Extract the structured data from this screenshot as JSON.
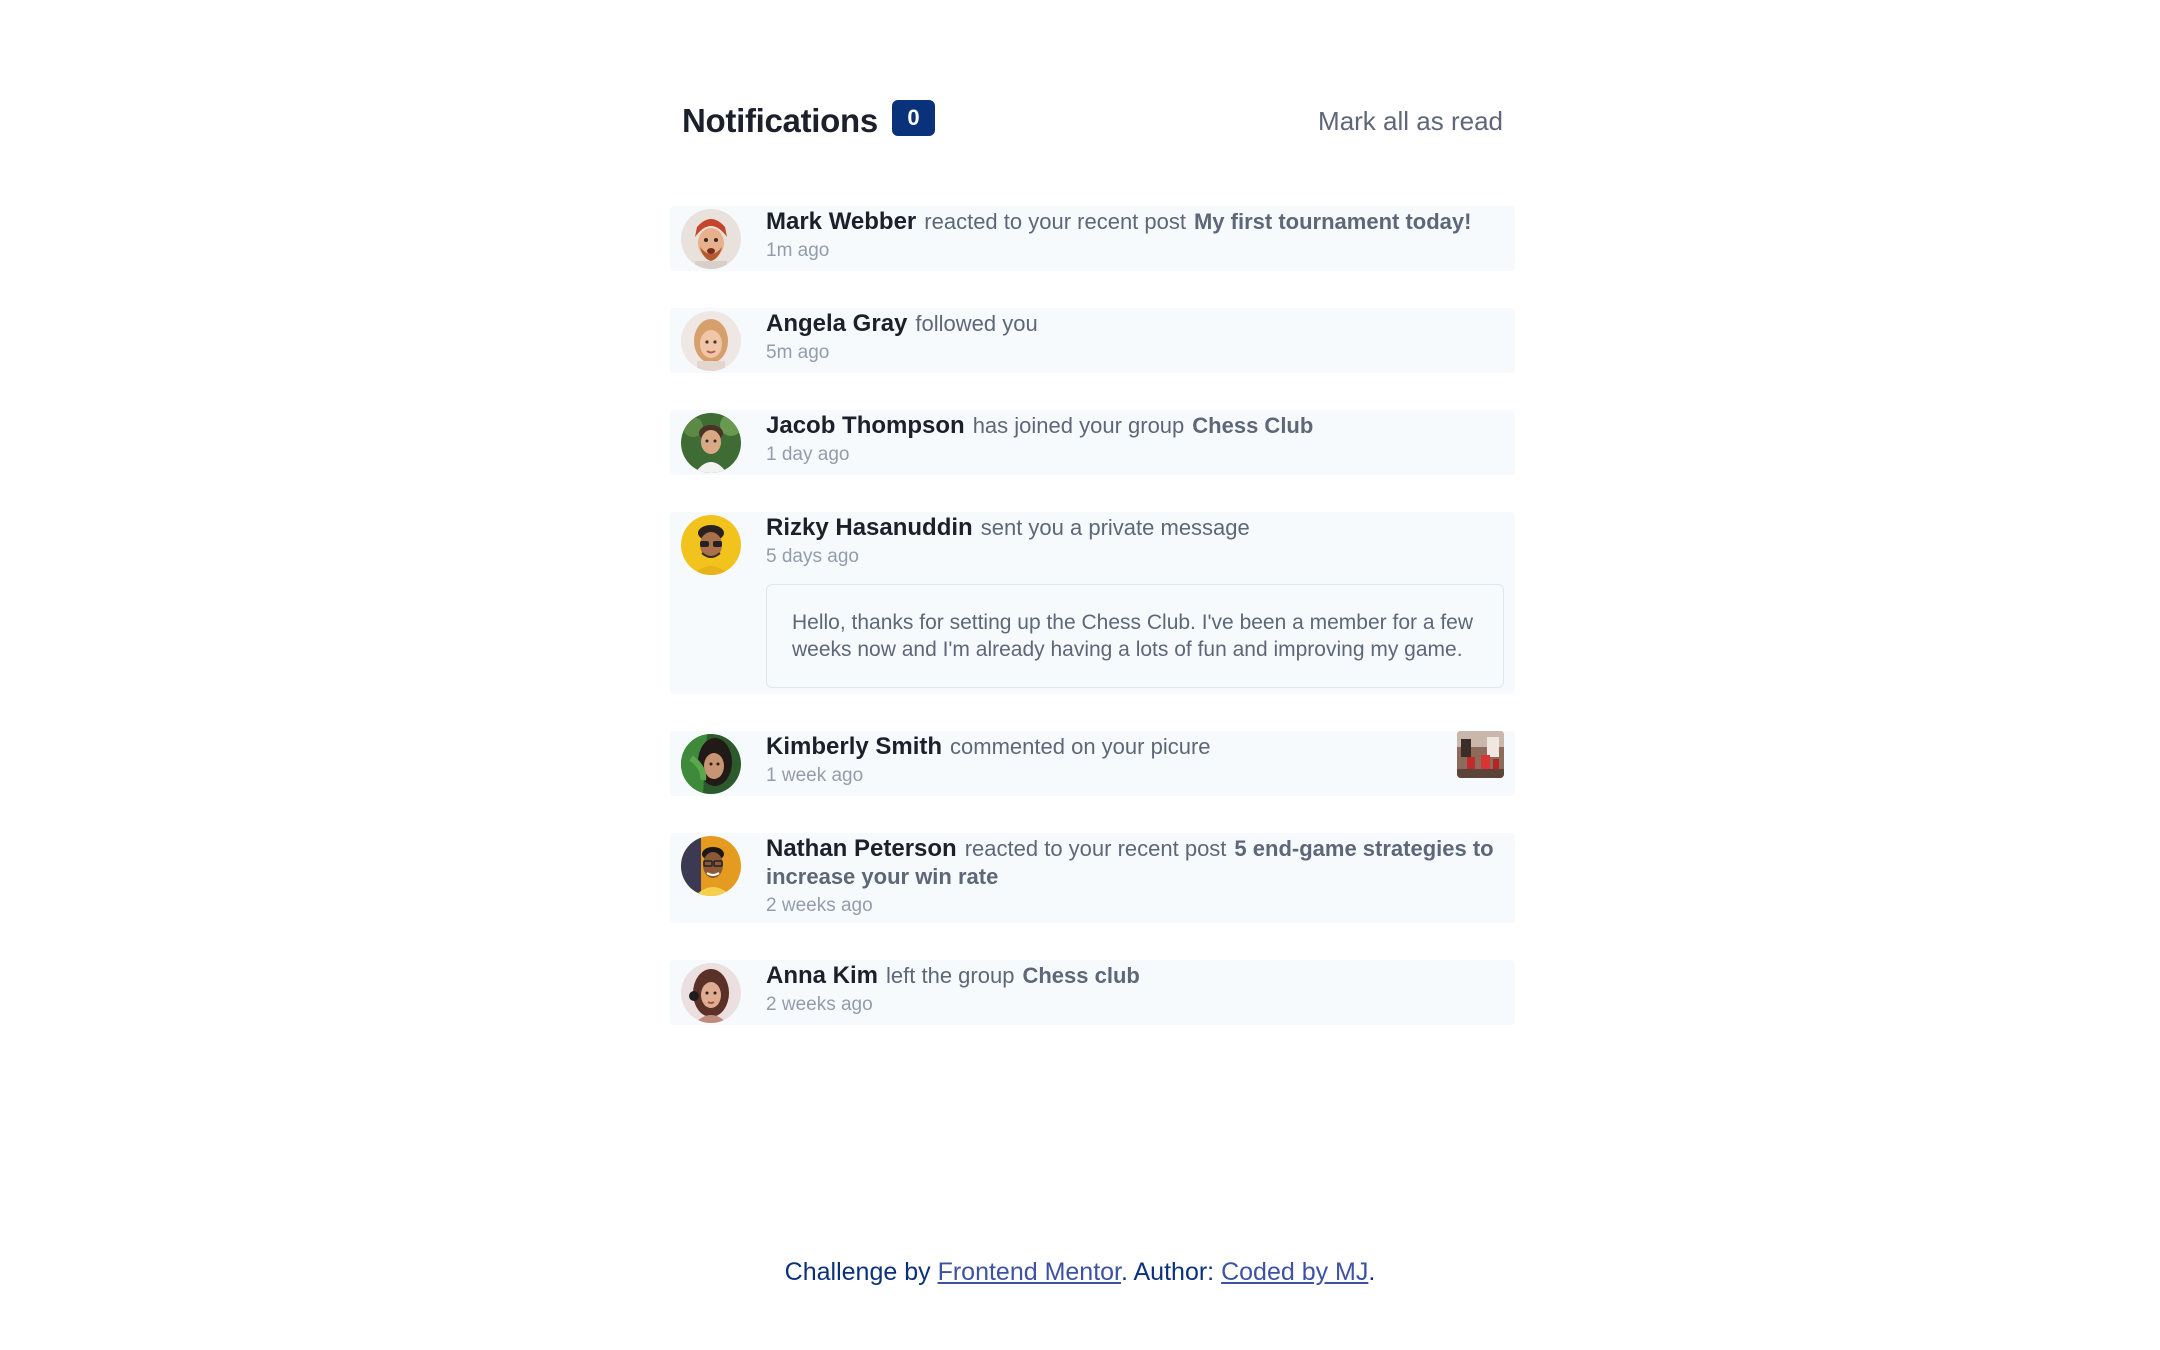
{
  "header": {
    "title": "Notifications",
    "unread_count": "0",
    "mark_all_label": "Mark all as read"
  },
  "colors": {
    "badge": "#0a327b",
    "item_bg": "#f7fafd",
    "name": "#1c202b",
    "muted": "#5e6778",
    "time": "#939cad"
  },
  "notifications": [
    {
      "name": "Mark Webber",
      "action": "reacted to your recent post",
      "target": "My first tournament today!",
      "time": "1m ago",
      "avatar": "avatar-mark-webber"
    },
    {
      "name": "Angela Gray",
      "action": "followed you",
      "target": "",
      "time": "5m ago",
      "avatar": "avatar-angela-gray"
    },
    {
      "name": "Jacob Thompson",
      "action": "has joined your group",
      "target": "Chess Club",
      "time": "1 day ago",
      "avatar": "avatar-jacob-thompson"
    },
    {
      "name": "Rizky Hasanuddin",
      "action": "sent you a private message",
      "target": "",
      "time": "5 days ago",
      "message": "Hello, thanks for setting up the Chess Club. I've been a member for a few weeks now and I'm already having a lots of fun and improving my game.",
      "avatar": "avatar-rizky-hasanuddin"
    },
    {
      "name": "Kimberly Smith",
      "action": "commented on your picure",
      "target": "",
      "time": "1 week ago",
      "avatar": "avatar-kimberly-smith",
      "thumbnail": "chess-picture-thumbnail"
    },
    {
      "name": "Nathan Peterson",
      "action": "reacted to your recent post",
      "target": "5 end-game strategies to increase your win rate",
      "time": "2 weeks ago",
      "avatar": "avatar-nathan-peterson"
    },
    {
      "name": "Anna Kim",
      "action": "left the group",
      "target": "Chess club",
      "time": "2 weeks ago",
      "avatar": "avatar-anna-kim"
    }
  ],
  "footer": {
    "prefix": "Challenge by",
    "link1": "Frontend Mentor",
    "middle": ". Author:",
    "link2": "Coded by MJ",
    "suffix": "."
  }
}
